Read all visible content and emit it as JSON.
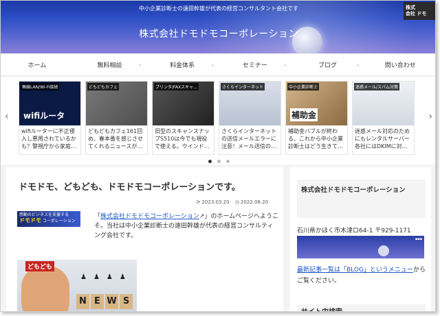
{
  "header": {
    "tagline": "中小企業診断士の遠田幹雄が代表の経営コンサルタント会社です",
    "site_title": "株式会社ドモドモコーポレーション",
    "logo_line1": "株式",
    "logo_line2": "会社 ドモ"
  },
  "nav": {
    "items": [
      {
        "label": "ホーム"
      },
      {
        "label": "無料相談"
      },
      {
        "label": "料金体系"
      },
      {
        "label": "セミナー"
      },
      {
        "label": "ブログ"
      },
      {
        "label": "問い合わせ"
      }
    ]
  },
  "carousel": {
    "cards": [
      {
        "tag": "無線LAN/Wi-Fi接続",
        "thumb_text": "wifiルータ",
        "title": "wifiルーターに不正侵入し悪用されているかも？警視庁から家庭…",
        "color": "#0b1a45"
      },
      {
        "tag": "どもどもカフェ",
        "thumb_text": "",
        "title": "どもどもカフェ161回め、春本番を感じさせてくれるニュースが…",
        "color": "#6a6a6a"
      },
      {
        "tag": "プリンタ/FAXスキャ…",
        "thumb_text": "",
        "title": "旧型のスキャンスナップS510は今でも現役で使える。ウインド…",
        "color": "#3a3a3a"
      },
      {
        "tag": "さくらインターネット",
        "thumb_text": "",
        "title": "さくらインターネットの送信メールエラーに注意！メール送信の…",
        "color": "#cfd6e2"
      },
      {
        "tag": "中小企業診断士",
        "thumb_text": "補助金",
        "title": "補助金バブルが終わる、これから中小企業診断士はどう生きて…",
        "color": "#c9a87a"
      },
      {
        "tag": "迷惑メール/スパム対策",
        "thumb_text": "",
        "title": "迷惑メール対応のためにもレンタルサーバー各社にはDKIMに対…",
        "color": "#e4e8ee"
      }
    ],
    "prev_icon": "chevron-left-icon",
    "next_icon": "chevron-right-icon"
  },
  "post": {
    "title": "ドモドモ、どもども、ドモドモコーポレーションです。",
    "created": "2023.03.20",
    "updated": "2022.08.20",
    "banner_line1": "感動のビジネスを支援する",
    "banner_line2": "ドモドモ",
    "banner_line3": "コーポレーション",
    "intro_pre": "「",
    "intro_link": "株式会社ドモドモコーポレーション",
    "intro_post": "」のホームページへようこそ。当社は中小企業診断士の遠田幹雄が代表の経営コンサルティング会社です。",
    "photo_label": "どもども",
    "news_letters": [
      "N",
      "E",
      "W",
      "S"
    ]
  },
  "sidebar": {
    "heading": "株式会社ドモドモコーポレーション",
    "address": "石川県かほく市木津ロ64-1 〒929-1171",
    "link_text": "最新記事一覧は「BLOG」というメニュー",
    "after_link": "からご覧ください。",
    "next_heading": "サイト内検索"
  }
}
